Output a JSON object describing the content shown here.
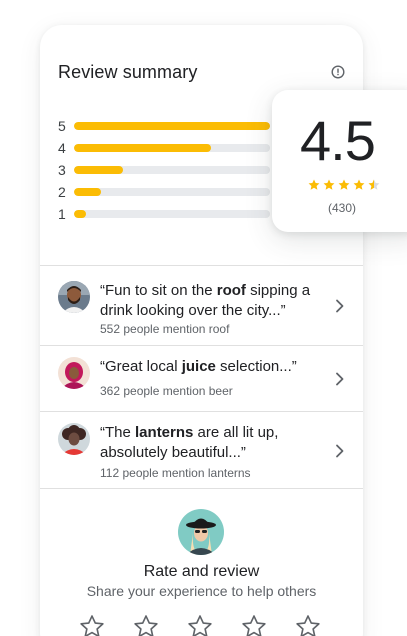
{
  "header": {
    "title": "Review summary",
    "info_icon": "info-icon"
  },
  "distribution": [
    {
      "stars": "5",
      "share": 1.0
    },
    {
      "stars": "4",
      "share": 0.7
    },
    {
      "stars": "3",
      "share": 0.25
    },
    {
      "stars": "2",
      "share": 0.14
    },
    {
      "stars": "1",
      "share": 0.06
    }
  ],
  "summary": {
    "score": "4.5",
    "stars_filled": 4.5,
    "count": "(430)"
  },
  "mentions": [
    {
      "avatar": "avatar-bearded-man",
      "quote_pre": "“Fun to sit on the ",
      "keyword": "roof",
      "quote_post": " sipping a drink looking over the city...”",
      "sub": "552 people mention roof"
    },
    {
      "avatar": "avatar-woman-headscarf",
      "quote_pre": "“Great local ",
      "keyword": "juice",
      "quote_post": " selection...”",
      "sub": "362 people mention beer"
    },
    {
      "avatar": "avatar-woman-curly-hair",
      "quote_pre": "“The ",
      "keyword": "lanterns",
      "quote_post": " are all lit up, absolutely beautiful...”",
      "sub": "112 people mention lanterns"
    }
  ],
  "rate": {
    "title": "Rate and review",
    "subtitle": "Share your experience to help others",
    "avatar": "avatar-woman-hat",
    "star_count": 5
  },
  "colors": {
    "accent_star": "#fbbc04",
    "track": "#e8eaed",
    "text_primary": "#202124",
    "text_secondary": "#5f6368"
  }
}
